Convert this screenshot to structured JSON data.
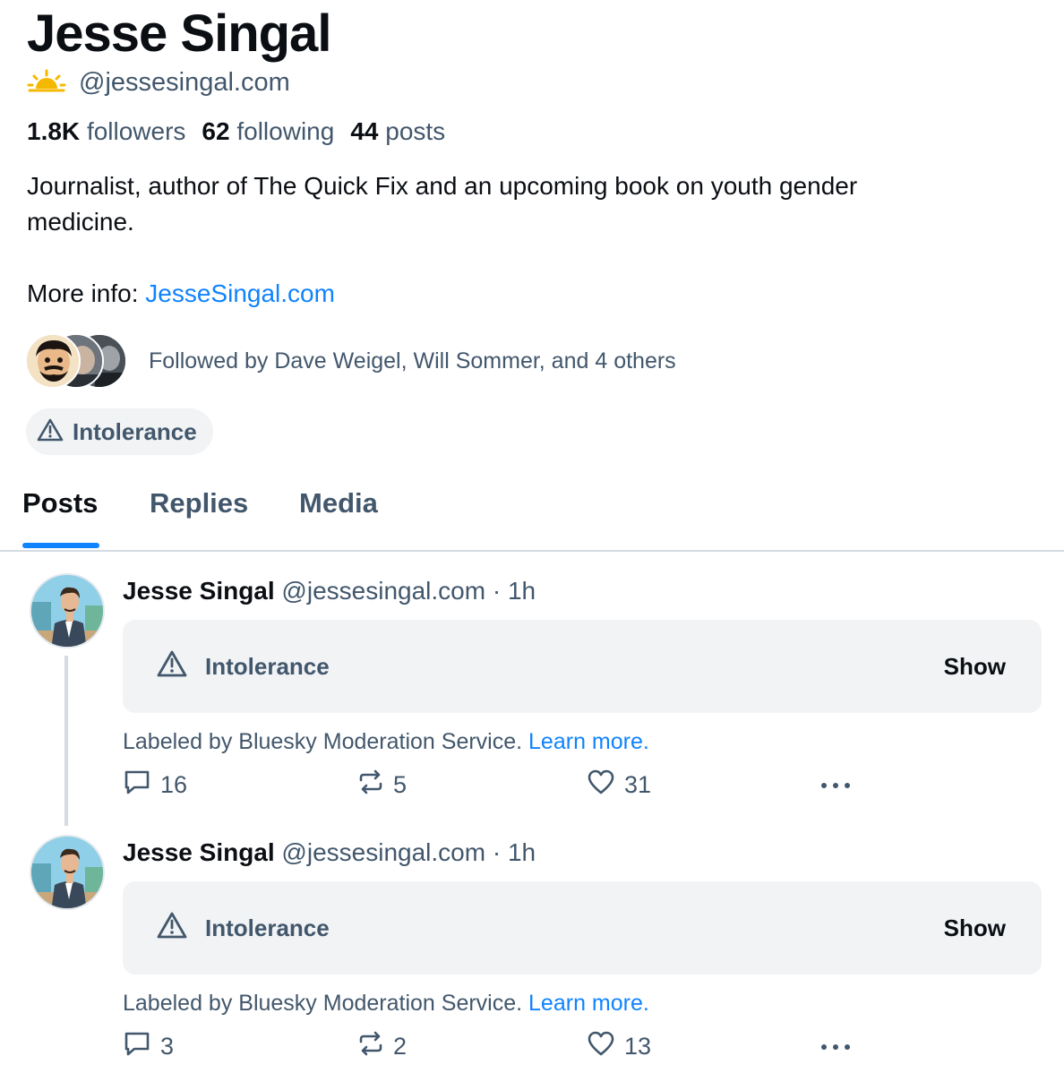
{
  "profile": {
    "name": "Jesse Singal",
    "handle": "@jessesingal.com",
    "stats": {
      "followers_count": "1.8K",
      "followers_label": "followers",
      "following_count": "62",
      "following_label": "following",
      "posts_count": "44",
      "posts_label": "posts"
    },
    "bio_line1": "Journalist, author of The Quick Fix and an upcoming book on youth gender",
    "bio_line2": "medicine.",
    "more_info_prefix": "More info: ",
    "more_info_link": "JesseSingal.com",
    "followed_by": "Followed by Dave Weigel, Will Sommer, and 4 others",
    "label": "Intolerance"
  },
  "tabs": [
    {
      "label": "Posts",
      "active": true
    },
    {
      "label": "Replies",
      "active": false
    },
    {
      "label": "Media",
      "active": false
    }
  ],
  "posts": [
    {
      "author": "Jesse Singal",
      "meta": " @jessesingal.com · 1h",
      "mod_label": "Intolerance",
      "show_label": "Show",
      "labeled_by": "Labeled by Bluesky Moderation Service. ",
      "learn_more": "Learn more.",
      "replies": "16",
      "reposts": "5",
      "likes": "31"
    },
    {
      "author": "Jesse Singal",
      "meta": " @jessesingal.com · 1h",
      "mod_label": "Intolerance",
      "show_label": "Show",
      "labeled_by": "Labeled by Bluesky Moderation Service. ",
      "learn_more": "Learn more.",
      "replies": "3",
      "reposts": "2",
      "likes": "13"
    }
  ],
  "colors": {
    "accent": "#1083fe",
    "muted_text": "#42576c",
    "label_bg": "#f1f3f5",
    "handle_icon": "#f5b800"
  },
  "icons": {
    "handle_badge": "sunrise-icon",
    "label": "warning-triangle-icon",
    "reply": "speech-bubble-icon",
    "repost": "repost-arrows-icon",
    "like": "heart-icon",
    "more": "ellipsis-icon"
  }
}
